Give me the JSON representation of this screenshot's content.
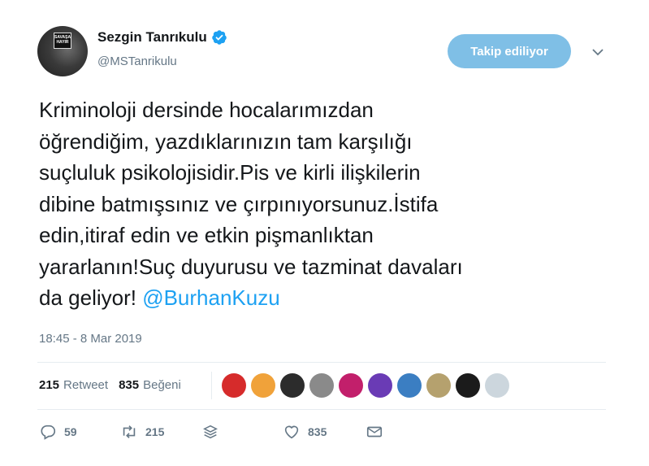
{
  "profile": {
    "name": "Sezgin Tanrıkulu",
    "handle": "@MSTanrikulu",
    "avatar_sign_text": "SAVAŞA HAYIR"
  },
  "follow_button": {
    "label": "Takip ediliyor"
  },
  "tweet": {
    "text": "Kriminoloji dersinde hocalarımızdan\nöğrendiğim,  yazdıklarınızın tam karşılığı\nsuçluluk psikolojisidir.Pis ve kirli ilişkilerin\ndibine batmışsınız ve çırpınıyorsunuz.İstifa\nedin,itiraf edin ve etkin pişmanlıktan\nyararlanın!Suç duyurusu ve tazminat davaları\nda geliyor! ",
    "mention": "@BurhanKuzu",
    "timestamp": "18:45 - 8 Mar 2019"
  },
  "stats": {
    "retweet_count": "215",
    "retweet_label": "Retweet",
    "like_count": "835",
    "like_label": "Beğeni"
  },
  "likers": [
    {
      "color": "#d62b2b"
    },
    {
      "color": "#f0a23a"
    },
    {
      "color": "#2c2c2c"
    },
    {
      "color": "#8a8a8a"
    },
    {
      "color": "#c21f6b"
    },
    {
      "color": "#6a3bb5"
    },
    {
      "color": "#3b7ec2"
    },
    {
      "color": "#b5a16e"
    },
    {
      "color": "#1b1b1b"
    },
    {
      "color": "#ccd6dd"
    }
  ],
  "actions": {
    "reply_count": "59",
    "retweet_count": "215",
    "like_count": "835"
  },
  "colors": {
    "accent": "#1da1f2",
    "follow_button_bg": "#7fbfe6",
    "secondary_text": "#657786"
  }
}
